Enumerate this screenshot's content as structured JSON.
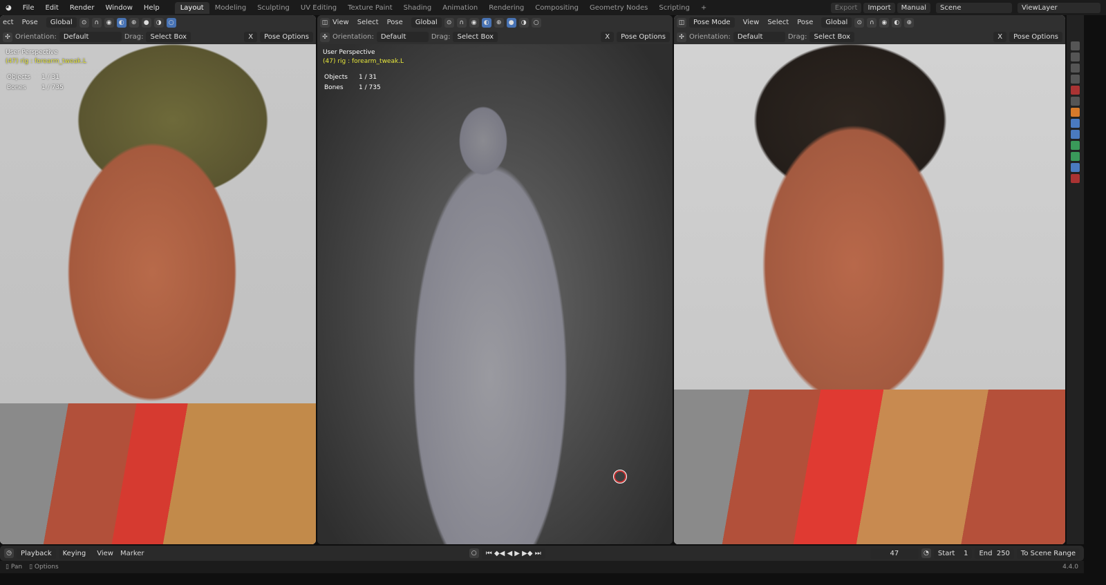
{
  "topbar": {
    "menus": [
      "File",
      "Edit",
      "Render",
      "Window",
      "Help"
    ],
    "workspaces": [
      "Layout",
      "Modeling",
      "Sculpting",
      "UV Editing",
      "Texture Paint",
      "Shading",
      "Animation",
      "Rendering",
      "Compositing",
      "Geometry Nodes",
      "Scripting"
    ],
    "active_workspace": "Layout",
    "add_tab": "+",
    "export": "Export",
    "import": "Import",
    "manual": "Manual",
    "scene": "Scene",
    "view_layer": "ViewLayer"
  },
  "viewports": [
    {
      "menus": [
        "ect",
        "Pose"
      ],
      "transform": "Global",
      "orientation_label": "Orientation:",
      "orientation": "Default",
      "drag_label": "Drag:",
      "drag": "Select Box",
      "x_label": "X",
      "pose_options": "Pose Options",
      "overlay": {
        "view": "User Perspective",
        "active": "(47) rig : forearm_tweak.L",
        "objects_label": "Objects",
        "objects": "1 / 31",
        "bones_label": "Bones",
        "bones": "1 / 735"
      }
    },
    {
      "menus": [
        "View",
        "Select",
        "Pose"
      ],
      "transform": "Global",
      "orientation_label": "Orientation:",
      "orientation": "Default",
      "drag_label": "Drag:",
      "drag": "Select Box",
      "x_label": "X",
      "pose_options": "Pose Options",
      "overlay": {
        "view": "User Perspective",
        "active": "(47) rig : forearm_tweak.L",
        "objects_label": "Objects",
        "objects": "1 / 31",
        "bones_label": "Bones",
        "bones": "1 / 735"
      }
    },
    {
      "mode": "Pose Mode",
      "menus": [
        "View",
        "Select",
        "Pose"
      ],
      "transform": "Global",
      "orientation_label": "Orientation:",
      "orientation": "Default",
      "drag_label": "Drag:",
      "drag": "Select Box",
      "x_label": "X",
      "pose_options": "Pose Options"
    }
  ],
  "timeline": {
    "menus": [
      "Playback",
      "Keying",
      "View",
      "Marker"
    ],
    "current_frame": "47",
    "start_label": "Start",
    "start": "1",
    "end_label": "End",
    "end": "250",
    "scene_range": "To Scene Range"
  },
  "status": {
    "pan": "Pan",
    "options": "Options",
    "version": "4.4.0"
  },
  "colors": {
    "accent": "#4772b3",
    "overlay_active": "#e6e63c"
  }
}
